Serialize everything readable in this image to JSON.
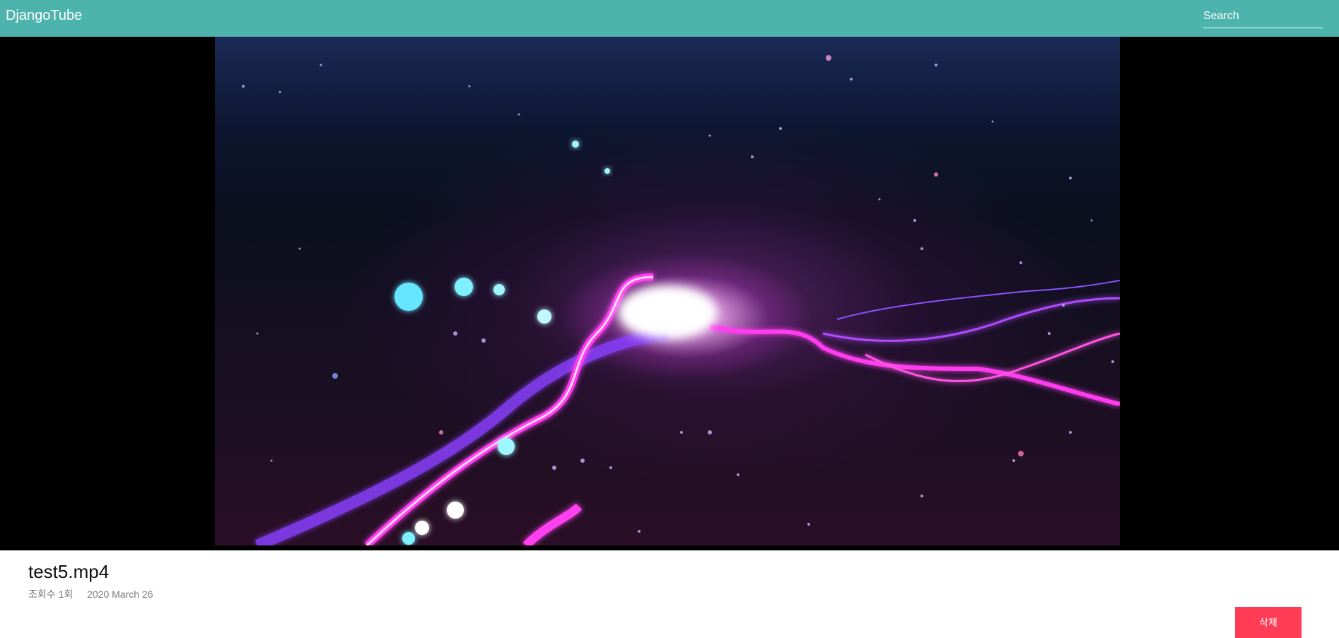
{
  "header": {
    "brand": "DjangoTube",
    "search_placeholder": "Search"
  },
  "video": {
    "title": "test5.mp4",
    "views": "조회수 1회",
    "date": "2020 March 26"
  },
  "actions": {
    "delete_label": "삭제"
  },
  "colors": {
    "header_bg": "#4db3ad",
    "delete_bg": "#ff3b55"
  }
}
